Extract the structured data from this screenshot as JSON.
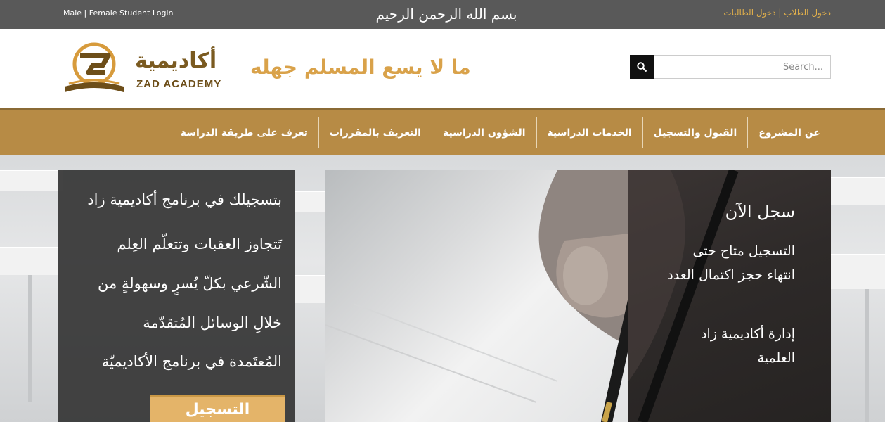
{
  "topbar": {
    "login_en": "Male | Female Student Login",
    "login_ar": "دخول الطلاب | دخول الطالبات",
    "basmala": "بسم الله الرحمن الرحيم"
  },
  "header": {
    "logo_ar": "أكاديمية",
    "logo_en": "ZAD ACADEMY",
    "tagline": "ما لا يسع المسلم جهله",
    "search_placeholder": "Search...",
    "search_icon": "search-icon"
  },
  "nav": {
    "items": [
      "عن المشروع",
      "القبول والتسجيل",
      "الخدمات الدراسية",
      "الشؤون الدراسية",
      "التعريف بالمقررات",
      "تعرف على طريقة الدراسة"
    ]
  },
  "hero": {
    "left": {
      "lines": [
        "بتسجيلك في برنامج أكاديمية زاد",
        "تَتجاوز العقبات وتتعلّم العِلم",
        "الشّرعي بكلّ يُسرٍ وسهولةٍ من",
        "خلالِ الوسائل المُتقدّمة",
        "المُعتَمدة في برنامج الأكاديميّة"
      ],
      "button": "التسجيل"
    },
    "right": {
      "title": "سجل الآن",
      "line1": "التسجيل متاح حتى",
      "line2": "انتهاء حجز اكتمال العدد",
      "line3": "إدارة أكاديمية زاد",
      "line4": "العلمية"
    }
  },
  "colors": {
    "topbar": "#595959",
    "accent_gold": "#b78b45",
    "login_ar": "#e2b04b",
    "tagline": "#d9a24a",
    "button": "#e4b469"
  }
}
